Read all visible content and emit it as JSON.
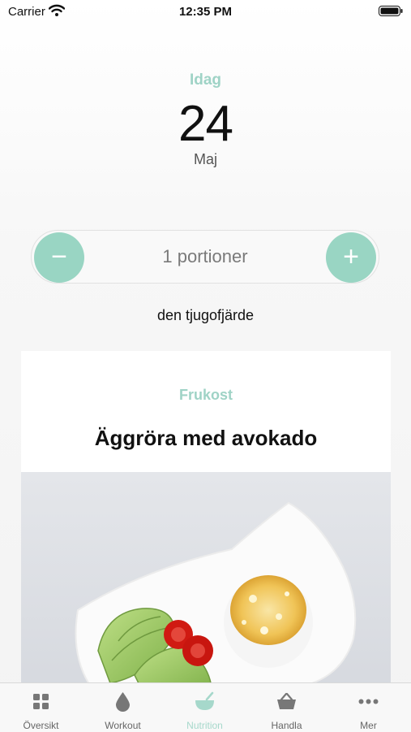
{
  "status_bar": {
    "carrier": "Carrier",
    "time": "12:35 PM"
  },
  "date": {
    "label": "Idag",
    "day": "24",
    "month": "Maj"
  },
  "portions": {
    "text": "1 portioner",
    "minus": "−",
    "plus": "+"
  },
  "ordinal": "den tjugofjärde",
  "meal": {
    "type": "Frukost",
    "title": "Äggröra med avokado"
  },
  "tabs": [
    {
      "label": "Översikt",
      "icon": "grid-icon"
    },
    {
      "label": "Workout",
      "icon": "drop-icon"
    },
    {
      "label": "Nutrition",
      "icon": "bowl-icon",
      "active": true
    },
    {
      "label": "Handla",
      "icon": "basket-icon"
    },
    {
      "label": "Mer",
      "icon": "more-icon"
    }
  ],
  "colors": {
    "accent": "#99d5c3",
    "accent_text": "#9fd3c6"
  }
}
